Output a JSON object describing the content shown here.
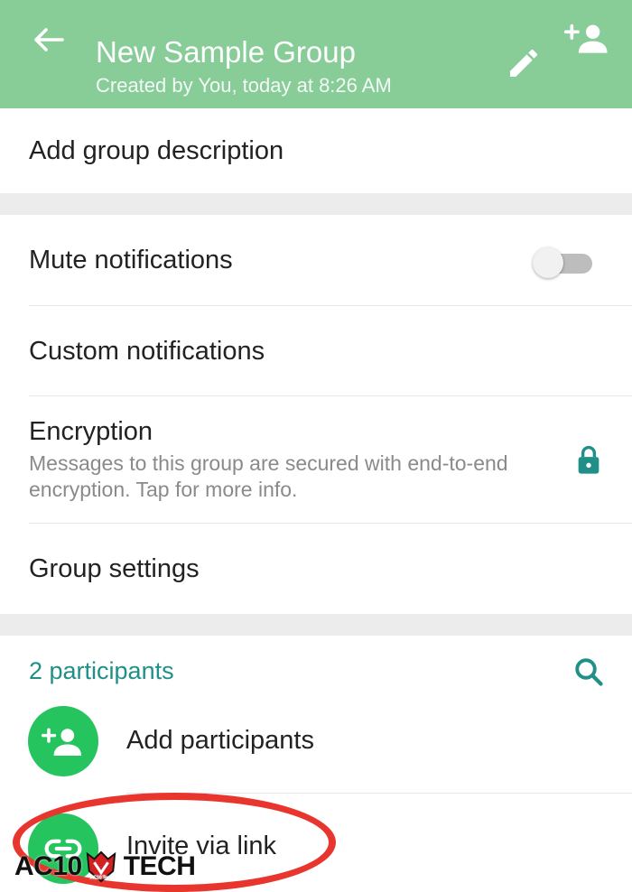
{
  "header": {
    "title": "New Sample Group",
    "subtitle": "Created by You, today at 8:26 AM",
    "back_icon": "arrow-left-icon",
    "edit_icon": "pencil-icon",
    "add_participant_icon": "person-add-icon"
  },
  "description": {
    "label": "Add group description"
  },
  "settings": {
    "mute": {
      "label": "Mute notifications",
      "enabled": false
    },
    "custom": {
      "label": "Custom notifications"
    },
    "encryption": {
      "label": "Encryption",
      "description": "Messages to this group are secured with end-to-end encryption. Tap for more info.",
      "icon": "lock-icon"
    },
    "group_settings": {
      "label": "Group settings"
    }
  },
  "participants": {
    "count_label": "2 participants",
    "search_icon": "search-icon",
    "add_label": "Add participants",
    "invite_label": "Invite via link"
  },
  "watermark": {
    "left_text": "AC10",
    "right_text": "TECH",
    "badge_text": "AC10 Tech"
  },
  "colors": {
    "header": "#88cc98",
    "accent_teal": "#1f8f88",
    "action_green": "#25c45e",
    "annotation_red": "#e8352e"
  }
}
